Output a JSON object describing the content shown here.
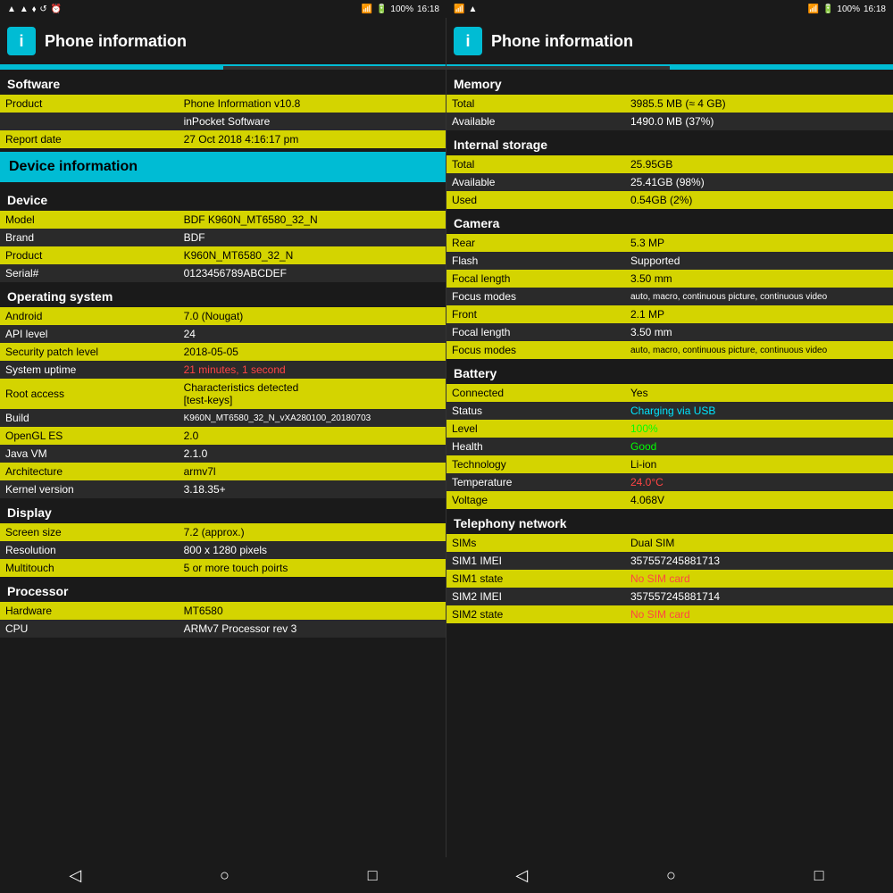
{
  "statusBar": {
    "left": {
      "icons": [
        "signal",
        "wifi",
        "bt",
        "sync",
        "alarm"
      ]
    },
    "right1": {
      "battery": "100%",
      "time": "16:18"
    },
    "right2": {
      "battery": "100%",
      "time": "16:18"
    }
  },
  "panel1": {
    "title": "Phone information",
    "icon": "i",
    "tabs": [
      {
        "active": true
      },
      {
        "active": false
      }
    ],
    "sections": [
      {
        "header": "Software",
        "rows": [
          {
            "label": "Product",
            "value": "Phone Information v10.8"
          },
          {
            "label": "",
            "value": "inPocket Software"
          },
          {
            "label": "Report date",
            "value": "27 Oct 2018 4:16:17 pm"
          }
        ]
      },
      {
        "deviceInfoHeader": "Device information"
      },
      {
        "header": "Device",
        "rows": [
          {
            "label": "Model",
            "value": "BDF K960N_MT6580_32_N"
          },
          {
            "label": "Brand",
            "value": "BDF"
          },
          {
            "label": "Product",
            "value": "K960N_MT6580_32_N"
          },
          {
            "label": "Serial#",
            "value": "0123456789ABCDEF"
          }
        ]
      },
      {
        "header": "Operating system",
        "rows": [
          {
            "label": "Android",
            "value": "7.0 (Nougat)"
          },
          {
            "label": "API level",
            "value": "24"
          },
          {
            "label": "Security patch level",
            "value": "2018-05-05"
          },
          {
            "label": "System uptime",
            "value": "21 minutes, 1 second",
            "valueClass": "value-red"
          },
          {
            "label": "Root access",
            "value": "Characteristics detected\n[test-keys]"
          },
          {
            "label": "Build",
            "value": "K960N_MT6580_32_N_vXA280100_20180703"
          },
          {
            "label": "OpenGL ES",
            "value": "2.0"
          },
          {
            "label": "Java VM",
            "value": "2.1.0"
          },
          {
            "label": "Architecture",
            "value": "armv7l"
          },
          {
            "label": "Kernel version",
            "value": "3.18.35+"
          }
        ]
      },
      {
        "header": "Display",
        "rows": [
          {
            "label": "Screen size",
            "value": "7.2 (approx.)"
          },
          {
            "label": "Resolution",
            "value": "800 x 1280 pixels"
          },
          {
            "label": "Multitouch",
            "value": "5 or more touch poirts"
          }
        ]
      },
      {
        "header": "Processor",
        "rows": [
          {
            "label": "Hardware",
            "value": "MT6580"
          },
          {
            "label": "CPU",
            "value": "ARMv7 Processor rev 3"
          }
        ]
      }
    ]
  },
  "panel2": {
    "title": "Phone information",
    "icon": "i",
    "tabs": [
      {
        "active": false
      },
      {
        "active": true
      }
    ],
    "sections": [
      {
        "header": "Memory",
        "rows": [
          {
            "label": "Total",
            "value": "3985.5 MB (≈ 4 GB)"
          },
          {
            "label": "Available",
            "value": "1490.0 MB (37%)"
          }
        ]
      },
      {
        "header": "Internal storage",
        "rows": [
          {
            "label": "Total",
            "value": "25.95GB"
          },
          {
            "label": "Available",
            "value": "25.41GB (98%)"
          },
          {
            "label": "Used",
            "value": "0.54GB (2%)"
          }
        ]
      },
      {
        "header": "Camera",
        "rows": [
          {
            "label": "Rear",
            "value": "5.3 MP"
          },
          {
            "label": "Flash",
            "value": "Supported"
          },
          {
            "label": "Focal length",
            "value": "3.50 mm"
          },
          {
            "label": "Focus modes",
            "value": "auto, macro, continuous picture, continuous video"
          }
        ]
      },
      {
        "header": "",
        "rows": [
          {
            "label": "Front",
            "value": "2.1 MP"
          },
          {
            "label": "Focal length",
            "value": "3.50 mm"
          },
          {
            "label": "Focus modes",
            "value": "auto, macro, continuous picture, continuous video"
          }
        ]
      },
      {
        "header": "Battery",
        "rows": [
          {
            "label": "Connected",
            "value": "Yes"
          },
          {
            "label": "Status",
            "value": "Charging via USB",
            "valueClass": "value-cyan"
          },
          {
            "label": "Level",
            "value": "100%",
            "valueClass": "value-green"
          },
          {
            "label": "Health",
            "value": "Good",
            "valueClass": "value-green"
          },
          {
            "label": "Technology",
            "value": "Li-ion"
          },
          {
            "label": "Temperature",
            "value": "24.0°C",
            "valueClass": "value-red"
          },
          {
            "label": "Voltage",
            "value": "4.068V"
          }
        ]
      },
      {
        "header": "Telephony network",
        "rows": [
          {
            "label": "SIMs",
            "value": "Dual SIM"
          },
          {
            "label": "SIM1 IMEI",
            "value": "357557245881713"
          },
          {
            "label": "SIM1 state",
            "value": "No SIM card",
            "valueClass": "value-red"
          },
          {
            "label": "SIM2 IMEI",
            "value": "357557245881714"
          },
          {
            "label": "SIM2 state",
            "value": "No SIM card",
            "valueClass": "value-red"
          }
        ]
      }
    ]
  },
  "nav": {
    "back": "◁",
    "home": "○",
    "recent": "□"
  }
}
